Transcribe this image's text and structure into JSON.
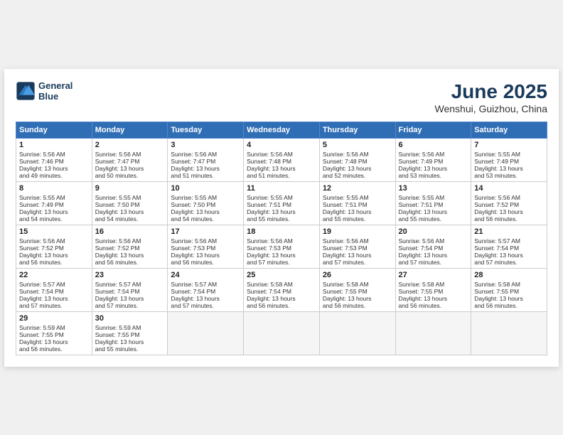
{
  "header": {
    "logo_line1": "General",
    "logo_line2": "Blue",
    "month": "June 2025",
    "location": "Wenshui, Guizhou, China"
  },
  "weekdays": [
    "Sunday",
    "Monday",
    "Tuesday",
    "Wednesday",
    "Thursday",
    "Friday",
    "Saturday"
  ],
  "weeks": [
    [
      {
        "day": "1",
        "lines": [
          "Sunrise: 5:56 AM",
          "Sunset: 7:46 PM",
          "Daylight: 13 hours",
          "and 49 minutes."
        ]
      },
      {
        "day": "2",
        "lines": [
          "Sunrise: 5:56 AM",
          "Sunset: 7:47 PM",
          "Daylight: 13 hours",
          "and 50 minutes."
        ]
      },
      {
        "day": "3",
        "lines": [
          "Sunrise: 5:56 AM",
          "Sunset: 7:47 PM",
          "Daylight: 13 hours",
          "and 51 minutes."
        ]
      },
      {
        "day": "4",
        "lines": [
          "Sunrise: 5:56 AM",
          "Sunset: 7:48 PM",
          "Daylight: 13 hours",
          "and 51 minutes."
        ]
      },
      {
        "day": "5",
        "lines": [
          "Sunrise: 5:56 AM",
          "Sunset: 7:48 PM",
          "Daylight: 13 hours",
          "and 52 minutes."
        ]
      },
      {
        "day": "6",
        "lines": [
          "Sunrise: 5:56 AM",
          "Sunset: 7:49 PM",
          "Daylight: 13 hours",
          "and 53 minutes."
        ]
      },
      {
        "day": "7",
        "lines": [
          "Sunrise: 5:55 AM",
          "Sunset: 7:49 PM",
          "Daylight: 13 hours",
          "and 53 minutes."
        ]
      }
    ],
    [
      {
        "day": "8",
        "lines": [
          "Sunrise: 5:55 AM",
          "Sunset: 7:49 PM",
          "Daylight: 13 hours",
          "and 54 minutes."
        ]
      },
      {
        "day": "9",
        "lines": [
          "Sunrise: 5:55 AM",
          "Sunset: 7:50 PM",
          "Daylight: 13 hours",
          "and 54 minutes."
        ]
      },
      {
        "day": "10",
        "lines": [
          "Sunrise: 5:55 AM",
          "Sunset: 7:50 PM",
          "Daylight: 13 hours",
          "and 54 minutes."
        ]
      },
      {
        "day": "11",
        "lines": [
          "Sunrise: 5:55 AM",
          "Sunset: 7:51 PM",
          "Daylight: 13 hours",
          "and 55 minutes."
        ]
      },
      {
        "day": "12",
        "lines": [
          "Sunrise: 5:55 AM",
          "Sunset: 7:51 PM",
          "Daylight: 13 hours",
          "and 55 minutes."
        ]
      },
      {
        "day": "13",
        "lines": [
          "Sunrise: 5:55 AM",
          "Sunset: 7:51 PM",
          "Daylight: 13 hours",
          "and 55 minutes."
        ]
      },
      {
        "day": "14",
        "lines": [
          "Sunrise: 5:56 AM",
          "Sunset: 7:52 PM",
          "Daylight: 13 hours",
          "and 56 minutes."
        ]
      }
    ],
    [
      {
        "day": "15",
        "lines": [
          "Sunrise: 5:56 AM",
          "Sunset: 7:52 PM",
          "Daylight: 13 hours",
          "and 56 minutes."
        ]
      },
      {
        "day": "16",
        "lines": [
          "Sunrise: 5:56 AM",
          "Sunset: 7:52 PM",
          "Daylight: 13 hours",
          "and 56 minutes."
        ]
      },
      {
        "day": "17",
        "lines": [
          "Sunrise: 5:56 AM",
          "Sunset: 7:53 PM",
          "Daylight: 13 hours",
          "and 56 minutes."
        ]
      },
      {
        "day": "18",
        "lines": [
          "Sunrise: 5:56 AM",
          "Sunset: 7:53 PM",
          "Daylight: 13 hours",
          "and 57 minutes."
        ]
      },
      {
        "day": "19",
        "lines": [
          "Sunrise: 5:56 AM",
          "Sunset: 7:53 PM",
          "Daylight: 13 hours",
          "and 57 minutes."
        ]
      },
      {
        "day": "20",
        "lines": [
          "Sunrise: 5:56 AM",
          "Sunset: 7:54 PM",
          "Daylight: 13 hours",
          "and 57 minutes."
        ]
      },
      {
        "day": "21",
        "lines": [
          "Sunrise: 5:57 AM",
          "Sunset: 7:54 PM",
          "Daylight: 13 hours",
          "and 57 minutes."
        ]
      }
    ],
    [
      {
        "day": "22",
        "lines": [
          "Sunrise: 5:57 AM",
          "Sunset: 7:54 PM",
          "Daylight: 13 hours",
          "and 57 minutes."
        ]
      },
      {
        "day": "23",
        "lines": [
          "Sunrise: 5:57 AM",
          "Sunset: 7:54 PM",
          "Daylight: 13 hours",
          "and 57 minutes."
        ]
      },
      {
        "day": "24",
        "lines": [
          "Sunrise: 5:57 AM",
          "Sunset: 7:54 PM",
          "Daylight: 13 hours",
          "and 57 minutes."
        ]
      },
      {
        "day": "25",
        "lines": [
          "Sunrise: 5:58 AM",
          "Sunset: 7:54 PM",
          "Daylight: 13 hours",
          "and 56 minutes."
        ]
      },
      {
        "day": "26",
        "lines": [
          "Sunrise: 5:58 AM",
          "Sunset: 7:55 PM",
          "Daylight: 13 hours",
          "and 56 minutes."
        ]
      },
      {
        "day": "27",
        "lines": [
          "Sunrise: 5:58 AM",
          "Sunset: 7:55 PM",
          "Daylight: 13 hours",
          "and 56 minutes."
        ]
      },
      {
        "day": "28",
        "lines": [
          "Sunrise: 5:58 AM",
          "Sunset: 7:55 PM",
          "Daylight: 13 hours",
          "and 56 minutes."
        ]
      }
    ],
    [
      {
        "day": "29",
        "lines": [
          "Sunrise: 5:59 AM",
          "Sunset: 7:55 PM",
          "Daylight: 13 hours",
          "and 56 minutes."
        ]
      },
      {
        "day": "30",
        "lines": [
          "Sunrise: 5:59 AM",
          "Sunset: 7:55 PM",
          "Daylight: 13 hours",
          "and 55 minutes."
        ]
      },
      null,
      null,
      null,
      null,
      null
    ]
  ]
}
